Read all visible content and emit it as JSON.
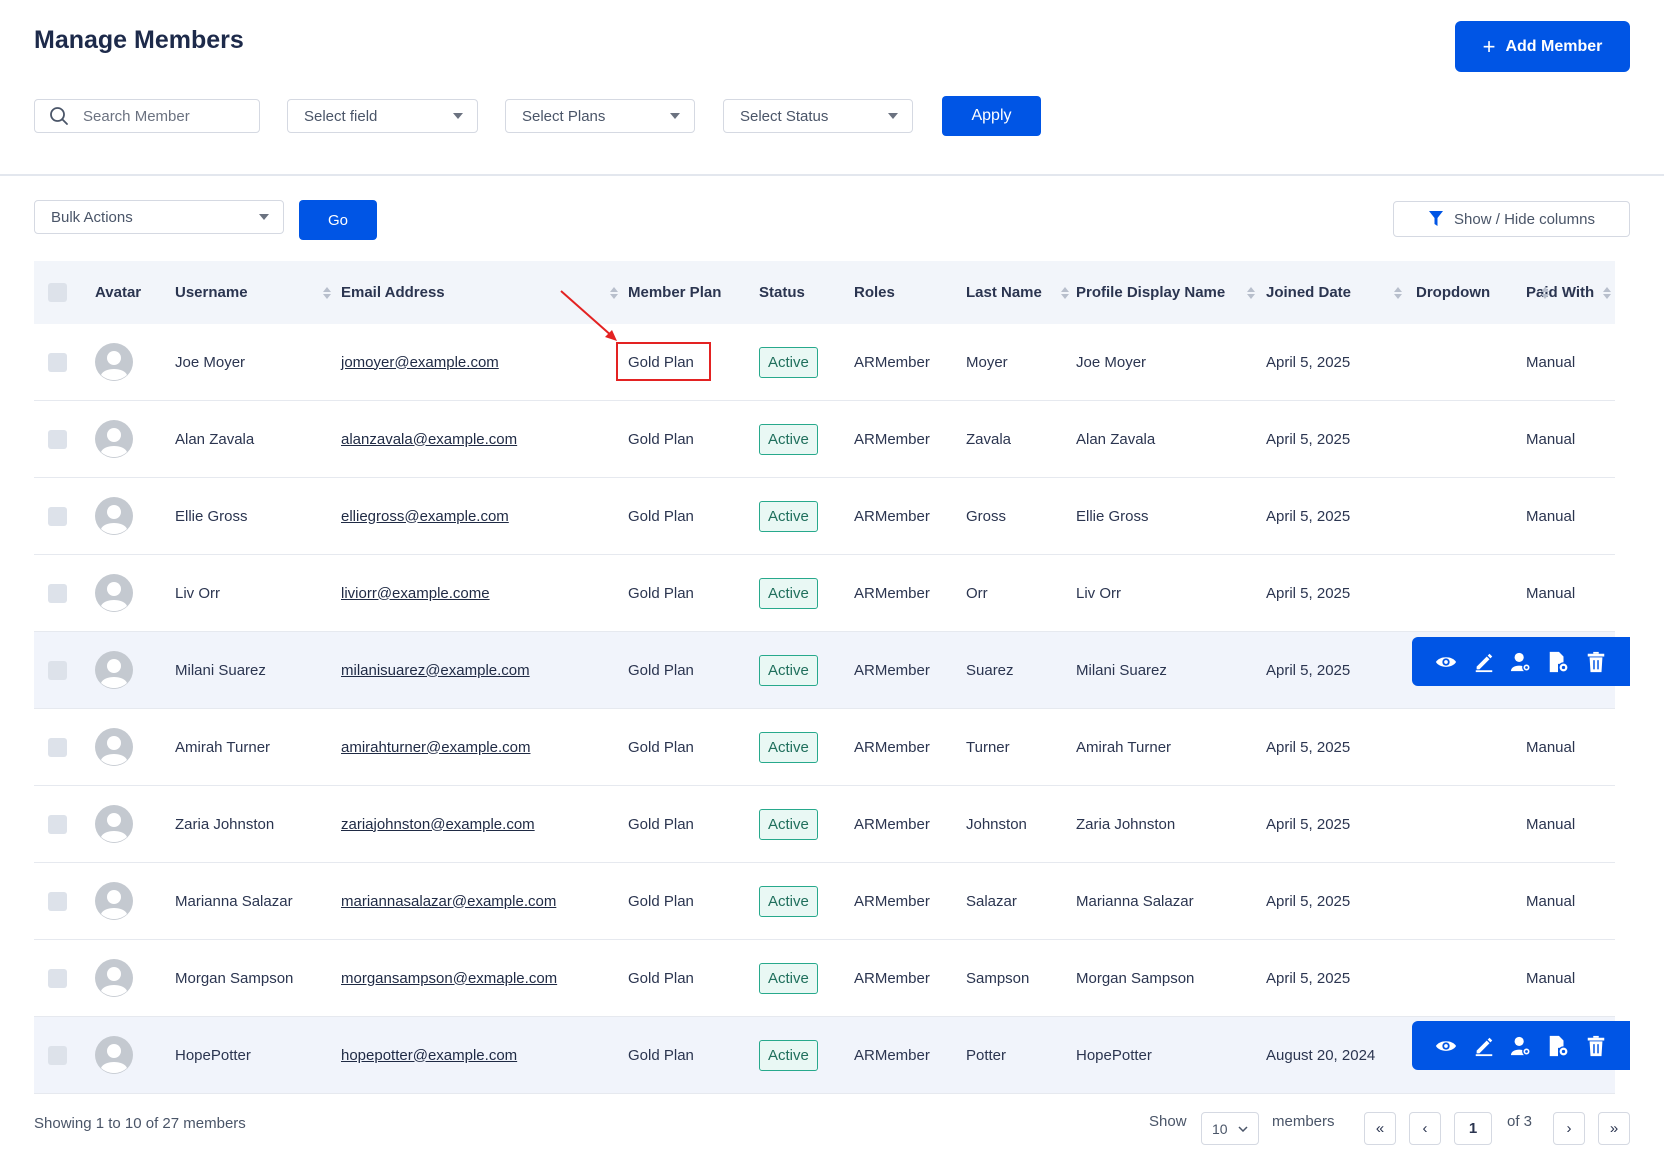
{
  "header": {
    "title": "Manage Members",
    "add_button": "Add Member"
  },
  "filters": {
    "search_placeholder": "Search Member",
    "field": "Select field",
    "plans": "Select Plans",
    "status": "Select Status",
    "apply": "Apply"
  },
  "toolbar": {
    "bulk": "Bulk Actions",
    "go": "Go",
    "show_hide": "Show / Hide columns"
  },
  "columns": {
    "avatar": "Avatar",
    "username": "Username",
    "email": "Email Address",
    "plan": "Member Plan",
    "status": "Status",
    "roles": "Roles",
    "last_name": "Last Name",
    "display_name": "Profile Display Name",
    "joined": "Joined Date",
    "dropdown": "Dropdown",
    "paid": "Paid With"
  },
  "rows": [
    {
      "username": "Joe Moyer",
      "email": "jomoyer@example.com",
      "plan": "Gold Plan",
      "status": "Active",
      "role": "ARMember",
      "last": "Moyer",
      "display": "Joe Moyer",
      "joined": "April 5, 2025",
      "paid": "Manual"
    },
    {
      "username": "Alan Zavala",
      "email": "alanzavala@example.com",
      "plan": "Gold Plan",
      "status": "Active",
      "role": "ARMember",
      "last": "Zavala",
      "display": "Alan Zavala",
      "joined": "April 5, 2025",
      "paid": "Manual"
    },
    {
      "username": "Ellie Gross",
      "email": "elliegross@example.com",
      "plan": "Gold Plan",
      "status": "Active",
      "role": "ARMember",
      "last": "Gross",
      "display": "Ellie Gross",
      "joined": "April 5, 2025",
      "paid": "Manual"
    },
    {
      "username": "Liv Orr",
      "email": "liviorr@example.come",
      "plan": "Gold Plan",
      "status": "Active",
      "role": "ARMember",
      "last": "Orr",
      "display": "Liv Orr",
      "joined": "April 5, 2025",
      "paid": "Manual"
    },
    {
      "username": "Milani Suarez",
      "email": "milanisuarez@example.com",
      "plan": "Gold Plan",
      "status": "Active",
      "role": "ARMember",
      "last": "Suarez",
      "display": "Milani Suarez",
      "joined": "April 5, 2025",
      "paid": ""
    },
    {
      "username": "Amirah Turner",
      "email": "amirahturner@example.com",
      "plan": "Gold Plan",
      "status": "Active",
      "role": "ARMember",
      "last": "Turner",
      "display": "Amirah Turner",
      "joined": "April 5, 2025",
      "paid": "Manual"
    },
    {
      "username": "Zaria Johnston",
      "email": "zariajohnston@example.com",
      "plan": "Gold Plan",
      "status": "Active",
      "role": "ARMember",
      "last": "Johnston",
      "display": "Zaria Johnston",
      "joined": "April 5, 2025",
      "paid": "Manual"
    },
    {
      "username": "Marianna Salazar",
      "email": "mariannasalazar@example.com",
      "plan": "Gold Plan",
      "status": "Active",
      "role": "ARMember",
      "last": "Salazar",
      "display": "Marianna Salazar",
      "joined": "April 5, 2025",
      "paid": "Manual"
    },
    {
      "username": "Morgan Sampson",
      "email": "morgansampson@exmaple.com",
      "plan": "Gold Plan",
      "status": "Active",
      "role": "ARMember",
      "last": "Sampson",
      "display": "Morgan Sampson",
      "joined": "April 5, 2025",
      "paid": "Manual"
    },
    {
      "username": "HopePotter",
      "email": "hopepotter@example.com",
      "plan": "Gold Plan",
      "status": "Active",
      "role": "ARMember",
      "last": "Potter",
      "display": "HopePotter",
      "joined": "August 20, 2024",
      "paid": ""
    }
  ],
  "row_actions": [
    "eye-icon",
    "edit-icon",
    "user-settings-icon",
    "document-settings-icon",
    "trash-icon"
  ],
  "annotation_color": "#e32222",
  "footer": {
    "summary": "Showing 1 to 10 of 27 members",
    "show": "Show",
    "per_page": "10",
    "members": "members",
    "first": "«",
    "prev": "‹",
    "page": "1",
    "of": "of 3",
    "next": "›",
    "last": "»"
  }
}
